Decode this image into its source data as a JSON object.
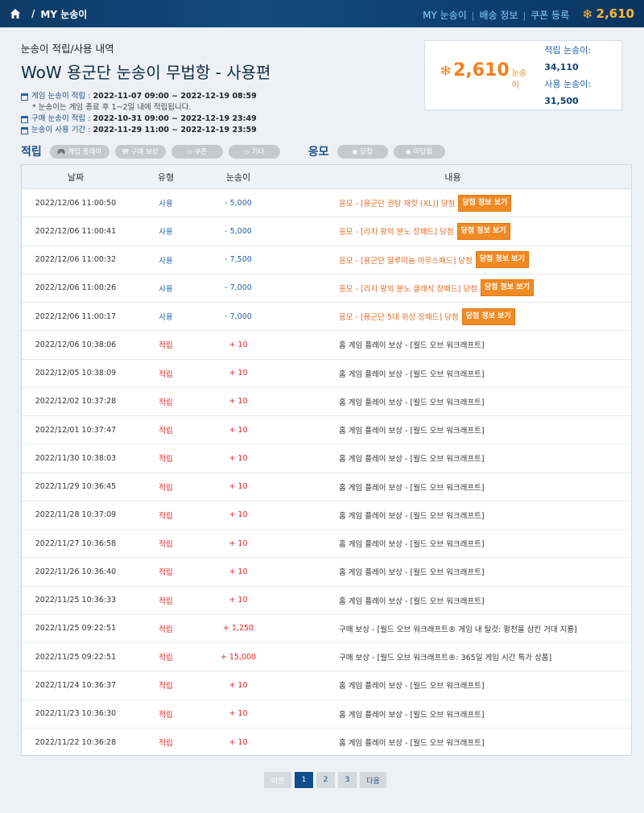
{
  "topbar": {
    "home_icon": "home-icon",
    "separator": "/",
    "breadcrumb": "MY 눈송이",
    "nav": [
      "MY 눈송이",
      "배송 정보",
      "쿠폰 등록"
    ],
    "nav_sep": "|",
    "balance": "2,610",
    "balance_icon": "snowflake-icon"
  },
  "header": {
    "subtitle": "눈송이 적립/사용 내역",
    "title": "WoW 용군단 눈송이 무법항 - 사용편",
    "periods": [
      {
        "label": "게임 눈송이 적립 :",
        "value": "2022-11-07 09:00 ~ 2022-12-19 08:59"
      },
      {
        "label": "구매 눈송이 적립 :",
        "value": "2022-10-31 09:00 ~ 2022-12-19 23:49"
      },
      {
        "label": "눈송이 사용 기간 :",
        "value": "2022-11-29 11:00 ~ 2022-12-19 23:59"
      }
    ],
    "note": "* 눈송이는 게임 종료 후 1~2일 내에 적립됩니다."
  },
  "summary": {
    "total": "2,610",
    "unit": "눈송이",
    "earned_label": "적립 눈송이:",
    "earned": "34,110",
    "used_label": "사용 눈송이:",
    "used": "31,500"
  },
  "filters": {
    "earn_title": "적립",
    "earn": [
      "게임 플레이",
      "구매 보상",
      "쿠폰",
      "기타"
    ],
    "entry_title": "응모",
    "entry": [
      "당첨",
      "미당첨"
    ]
  },
  "table": {
    "headers": [
      "날짜",
      "유형",
      "눈송이",
      "내용"
    ],
    "win_button": "당첨 정보 보기",
    "rows": [
      {
        "date": "2022/12/06 11:00:50",
        "type": "사용",
        "amount": "- 5,000",
        "desc": "응모 - [용군단 권탕 재킷 (XL)] 당첨",
        "kind": "use"
      },
      {
        "date": "2022/12/06 11:00:41",
        "type": "사용",
        "amount": "- 5,000",
        "desc": "응모 - [리치 왕의 분노 장패드] 당첨",
        "kind": "use"
      },
      {
        "date": "2022/12/06 11:00:32",
        "type": "사용",
        "amount": "- 7,500",
        "desc": "응모 - [용군단 알루미늄 마우스패드] 당첨",
        "kind": "use"
      },
      {
        "date": "2022/12/06 11:00:26",
        "type": "사용",
        "amount": "- 7,000",
        "desc": "응모 - [리치 왕의 분노 클래식 장패드] 당첨",
        "kind": "use"
      },
      {
        "date": "2022/12/06 11:00:17",
        "type": "사용",
        "amount": "- 7,000",
        "desc": "응모 - [용군단 5대 위상 장패드] 당첨",
        "kind": "use"
      },
      {
        "date": "2022/12/06 10:38:06",
        "type": "적립",
        "amount": "+ 10",
        "desc": "홈 게임 플레이 보상 - [월드 오브 워크래프트]",
        "kind": "earn"
      },
      {
        "date": "2022/12/05 10:38:09",
        "type": "적립",
        "amount": "+ 10",
        "desc": "홈 게임 플레이 보상 - [월드 오브 워크래프트]",
        "kind": "earn"
      },
      {
        "date": "2022/12/02 10:37:28",
        "type": "적립",
        "amount": "+ 10",
        "desc": "홈 게임 플레이 보상 - [월드 오브 워크래프트]",
        "kind": "earn"
      },
      {
        "date": "2022/12/01 10:37:47",
        "type": "적립",
        "amount": "+ 10",
        "desc": "홈 게임 플레이 보상 - [월드 오브 워크래프트]",
        "kind": "earn"
      },
      {
        "date": "2022/11/30 10:38:03",
        "type": "적립",
        "amount": "+ 10",
        "desc": "홈 게임 플레이 보상 - [월드 오브 워크래프트]",
        "kind": "earn"
      },
      {
        "date": "2022/11/29 10:36:45",
        "type": "적립",
        "amount": "+ 10",
        "desc": "홈 게임 플레이 보상 - [월드 오브 워크래프트]",
        "kind": "earn"
      },
      {
        "date": "2022/11/28 10:37:09",
        "type": "적립",
        "amount": "+ 10",
        "desc": "홈 게임 플레이 보상 - [월드 오브 워크래프트]",
        "kind": "earn"
      },
      {
        "date": "2022/11/27 10:36:58",
        "type": "적립",
        "amount": "+ 10",
        "desc": "홈 게임 플레이 보상 - [월드 오브 워크래프트]",
        "kind": "earn"
      },
      {
        "date": "2022/11/26 10:36:40",
        "type": "적립",
        "amount": "+ 10",
        "desc": "홈 게임 플레이 보상 - [월드 오브 워크래프트]",
        "kind": "earn"
      },
      {
        "date": "2022/11/25 10:36:33",
        "type": "적립",
        "amount": "+ 10",
        "desc": "홈 게임 플레이 보상 - [월드 오브 워크래프트]",
        "kind": "earn"
      },
      {
        "date": "2022/11/25 09:22:51",
        "type": "적립",
        "amount": "+ 1,250",
        "desc": "구매 보상 - [월드 오브 워크래프트® 게임 내 탈것: 황천을 삼킨 거대 지룡]",
        "kind": "earn"
      },
      {
        "date": "2022/11/25 09:22:51",
        "type": "적립",
        "amount": "+ 15,000",
        "desc": "구매 보상 - [월드 오브 워크래프트®: 365일 게임 시간 특가 상품]",
        "kind": "earn"
      },
      {
        "date": "2022/11/24 10:36:37",
        "type": "적립",
        "amount": "+ 10",
        "desc": "홈 게임 플레이 보상 - [월드 오브 워크래프트]",
        "kind": "earn"
      },
      {
        "date": "2022/11/23 10:36:30",
        "type": "적립",
        "amount": "+ 10",
        "desc": "홈 게임 플레이 보상 - [월드 오브 워크래프트]",
        "kind": "earn"
      },
      {
        "date": "2022/11/22 10:36:28",
        "type": "적립",
        "amount": "+ 10",
        "desc": "홈 게임 플레이 보상 - [월드 오브 워크래프트]",
        "kind": "earn"
      }
    ]
  },
  "pagination": {
    "prev": "이전",
    "pages": [
      "1",
      "2",
      "3"
    ],
    "current": "1",
    "next": "다음"
  },
  "colors": {
    "accent": "#0f4c8c",
    "earn": "#e5272b",
    "use": "#2563a8",
    "entry": "#e06a23",
    "win_button": "#f08a24",
    "balance": "#ffb833"
  }
}
